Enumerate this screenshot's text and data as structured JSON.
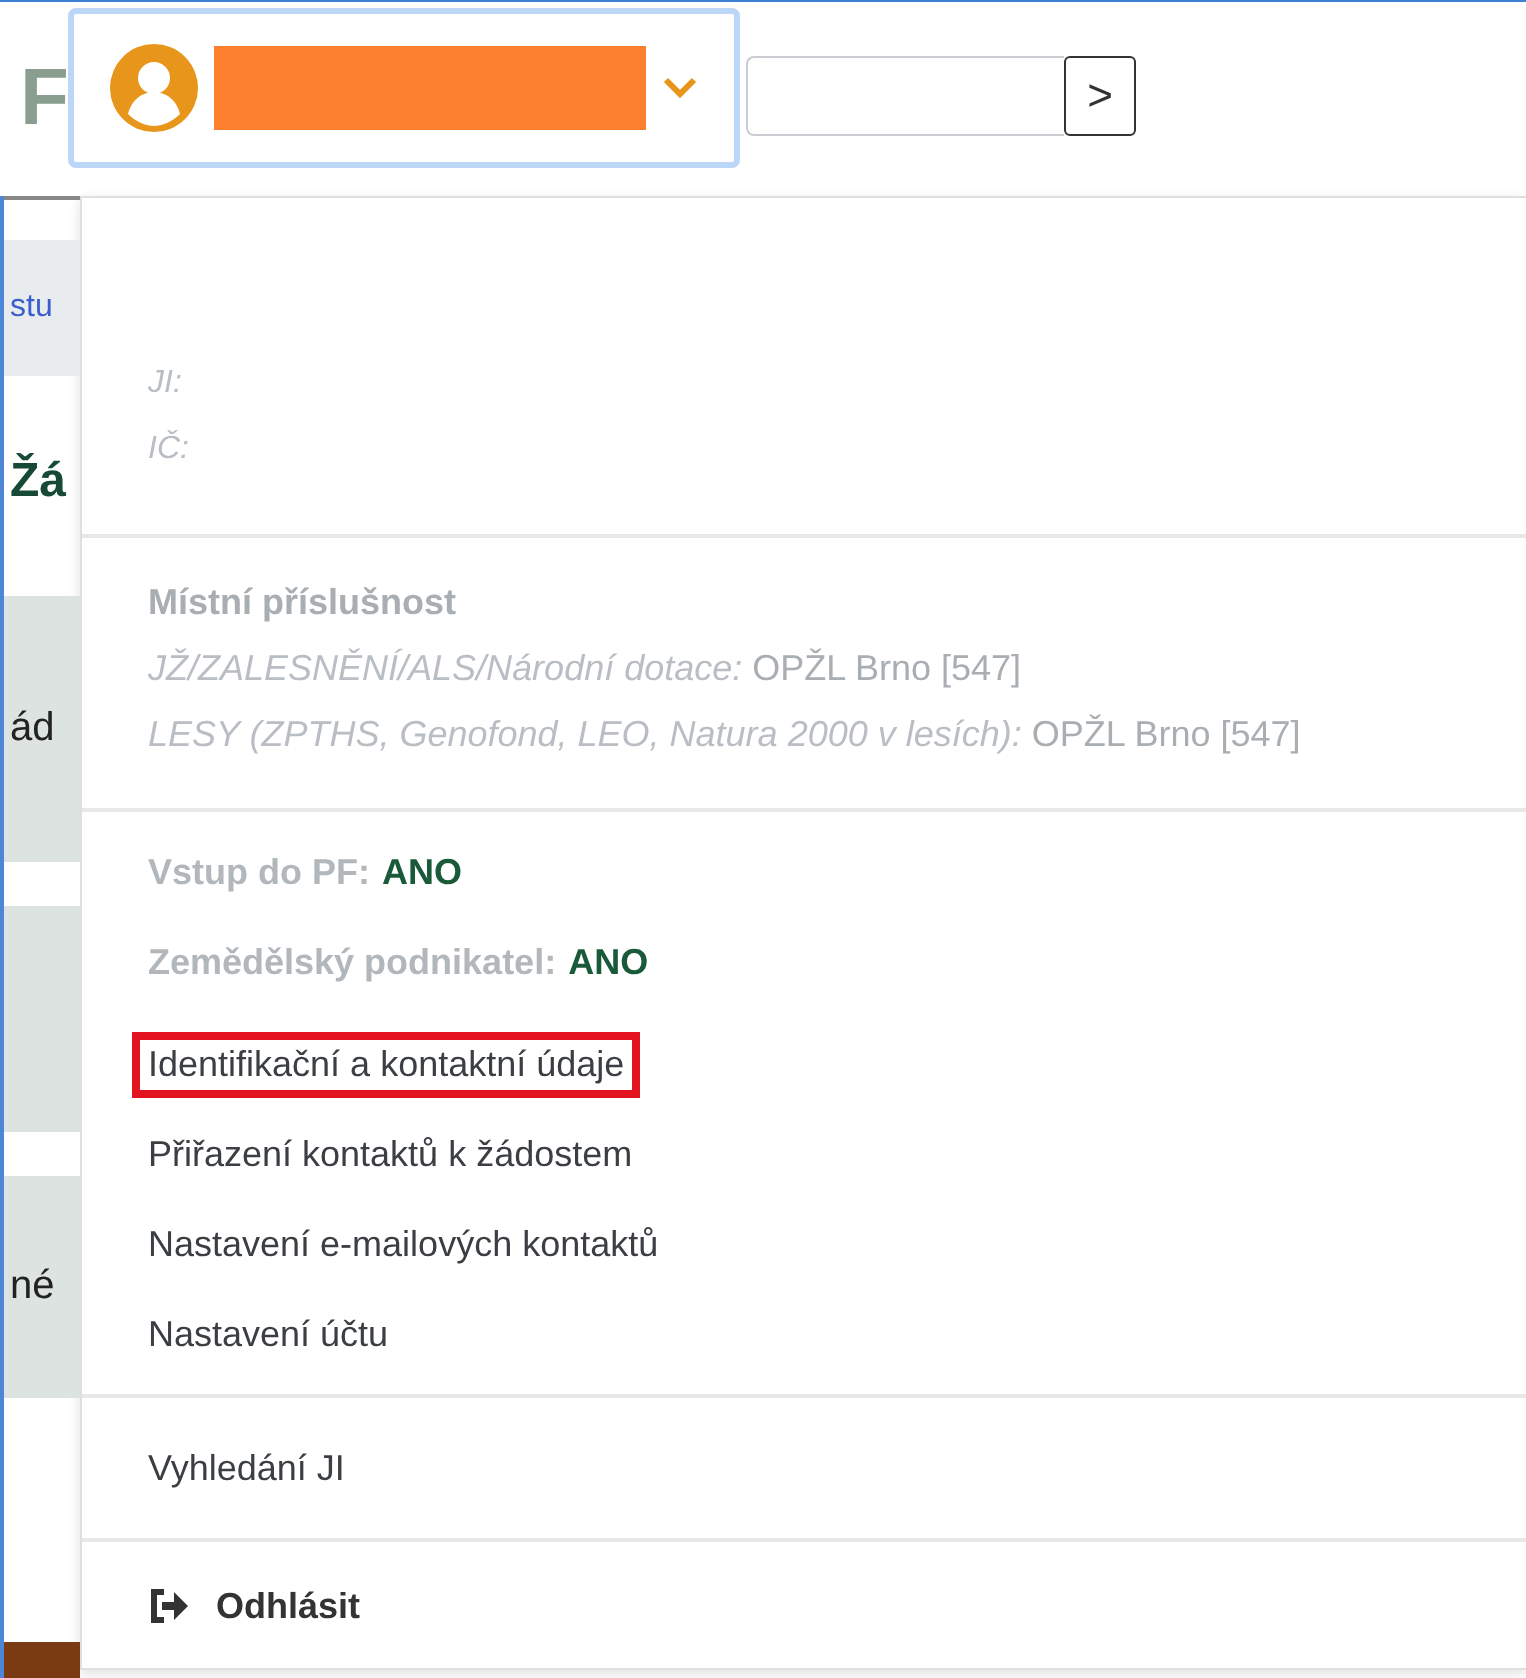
{
  "header": {
    "logo_fragment": "F",
    "user_button": {
      "expanded": true
    },
    "search": {
      "go": ">"
    }
  },
  "background": [
    {
      "text": "stu",
      "kind": "link"
    },
    {
      "text": "Žá",
      "kind": "heading"
    },
    {
      "text": "ád",
      "kind": "cell"
    },
    {
      "kind": "cell"
    },
    {
      "text": "né",
      "kind": "cell"
    }
  ],
  "user_menu": {
    "identity": [
      {
        "label": "JI:"
      },
      {
        "label": "IČ:"
      }
    ],
    "jurisdiction": {
      "title": "Místní příslušnost",
      "lines": [
        {
          "label": "JŽ/ZALESNĚNÍ/ALS/Národní dotace:",
          "value": "OPŽL Brno [547]"
        },
        {
          "label": "LESY (ZPTHS, Genofond, LEO, Natura 2000 v lesích):",
          "value": "OPŽL Brno [547]"
        }
      ]
    },
    "flags": [
      {
        "label": "Vstup do PF:",
        "value": "ANO"
      },
      {
        "label": "Zemědělský podnikatel:",
        "value": "ANO"
      }
    ],
    "links": [
      {
        "label": "Identifikační a kontaktní údaje",
        "highlighted": true
      },
      {
        "label": "Přiřazení kontaktů k žádostem",
        "highlighted": false
      },
      {
        "label": "Nastavení e-mailových kontaktů",
        "highlighted": false
      },
      {
        "label": "Nastavení účtu",
        "highlighted": false
      }
    ],
    "search_link": "Vyhledání JI",
    "logout": "Odhlásit"
  }
}
